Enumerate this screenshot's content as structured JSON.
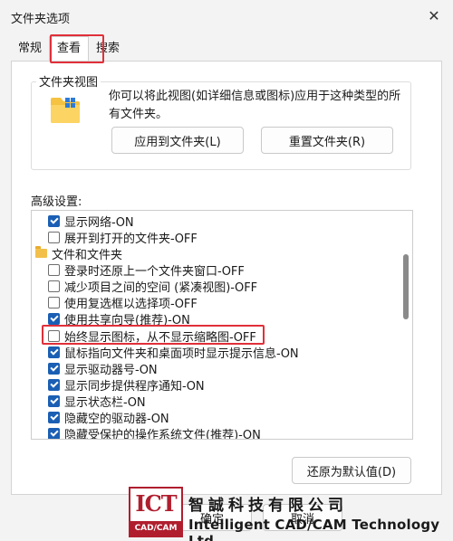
{
  "window": {
    "title": "文件夹选项",
    "close_glyph": "✕"
  },
  "tabs": [
    {
      "label": "常规"
    },
    {
      "label": "查看"
    },
    {
      "label": "搜索"
    }
  ],
  "folder_view": {
    "group_title": "文件夹视图",
    "description": "你可以将此视图(如详细信息或图标)应用于这种类型的所有文件夹。",
    "apply_button": "应用到文件夹(L)",
    "reset_button": "重置文件夹(R)"
  },
  "advanced": {
    "label": "高级设置:",
    "items": [
      {
        "type": "checkbox",
        "checked": true,
        "label": "显示网络-ON"
      },
      {
        "type": "checkbox",
        "checked": false,
        "label": "展开到打开的文件夹-OFF"
      },
      {
        "type": "folder",
        "label": "文件和文件夹"
      },
      {
        "type": "checkbox",
        "checked": false,
        "label": "登录时还原上一个文件夹窗口-OFF"
      },
      {
        "type": "checkbox",
        "checked": false,
        "label": "减少项目之间的空间 (紧凑视图)-OFF"
      },
      {
        "type": "checkbox",
        "checked": false,
        "label": "使用复选框以选择项-OFF"
      },
      {
        "type": "checkbox",
        "checked": true,
        "label": "使用共享向导(推荐)-ON"
      },
      {
        "type": "checkbox",
        "checked": false,
        "label": "始终显示图标，从不显示缩略图-OFF"
      },
      {
        "type": "checkbox",
        "checked": true,
        "label": "鼠标指向文件夹和桌面项时显示提示信息-ON"
      },
      {
        "type": "checkbox",
        "checked": true,
        "label": "显示驱动器号-ON"
      },
      {
        "type": "checkbox",
        "checked": true,
        "label": "显示同步提供程序通知-ON"
      },
      {
        "type": "checkbox",
        "checked": true,
        "label": "显示状态栏-ON"
      },
      {
        "type": "checkbox",
        "checked": true,
        "label": "隐藏空的驱动器-ON"
      },
      {
        "type": "checkbox",
        "checked": true,
        "label": "隐藏受保护的操作系统文件(推荐)-ON"
      }
    ],
    "restore_button": "还原为默认值(D)"
  },
  "footer": {
    "ok_button": "确定",
    "cancel_button": "取消"
  },
  "watermark": {
    "logo_text": "ICT",
    "logo_sub": "CAD/CAM",
    "company_cn": "智誠科技有限公司",
    "company_en": "Intelligent CAD/CAM Technology Ltd."
  },
  "colors": {
    "highlight": "#e0303a",
    "checkbox_accent": "#1a5fb4",
    "brand_red": "#b01e2e"
  }
}
